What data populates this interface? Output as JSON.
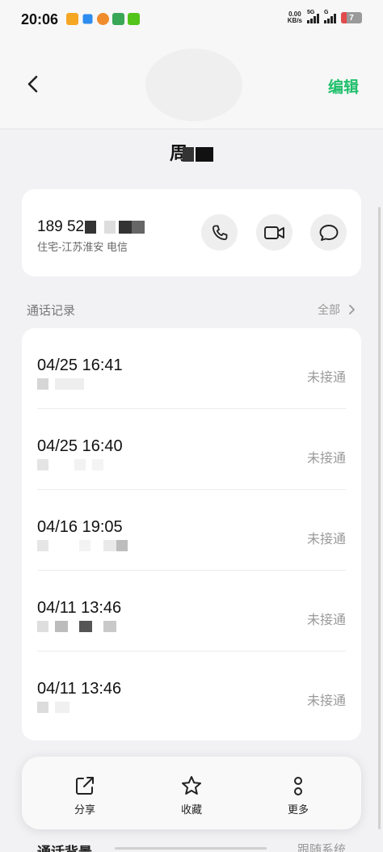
{
  "status_bar": {
    "time": "20:06",
    "net_speed_value": "0.00",
    "net_speed_unit": "KB/s",
    "signal_1_tag": "5G",
    "signal_2_tag": "G",
    "battery": "7"
  },
  "header": {
    "edit_label": "编辑",
    "contact_name": "周"
  },
  "phone": {
    "number": "189 52",
    "location": "住宅-江苏淮安 电信"
  },
  "call_log": {
    "title": "通话记录",
    "all_label": "全部",
    "entries": [
      {
        "time": "04/25 16:41",
        "status": "未接通"
      },
      {
        "time": "04/25 16:40",
        "status": "未接通"
      },
      {
        "time": "04/16 19:05",
        "status": "未接通"
      },
      {
        "time": "04/11 13:46",
        "status": "未接通"
      },
      {
        "time": "04/11 13:46",
        "status": "未接通"
      }
    ]
  },
  "bottom_bar": {
    "share": "分享",
    "favorite": "收藏",
    "more": "更多"
  },
  "peek_row": {
    "label": "通话背景",
    "value": "跟随系统"
  },
  "colors": {
    "accent": "#1fbf6b",
    "background": "#f2f2f4",
    "card": "#ffffff",
    "muted": "#9a9a9a"
  },
  "icons": [
    "back-arrow-icon",
    "phone-icon",
    "video-icon",
    "message-icon",
    "chevron-right-icon",
    "share-icon",
    "star-icon",
    "more-icon"
  ]
}
